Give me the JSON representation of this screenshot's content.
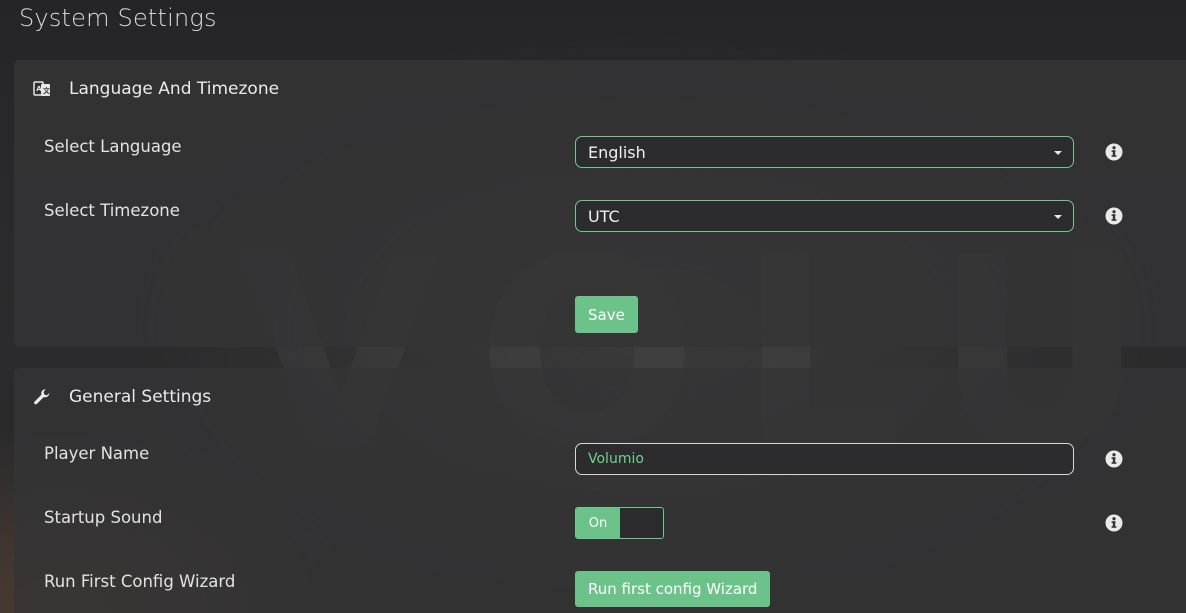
{
  "page": {
    "title": "System Settings",
    "watermark": "VOLUMIO"
  },
  "language_timezone": {
    "title": "Language And Timezone",
    "icon": "language-icon",
    "language": {
      "label": "Select Language",
      "value": "English"
    },
    "timezone": {
      "label": "Select Timezone",
      "value": "UTC"
    },
    "save_label": "Save"
  },
  "general": {
    "title": "General Settings",
    "icon": "wrench-icon",
    "player_name": {
      "label": "Player Name",
      "value": "Volumio"
    },
    "startup_sound": {
      "label": "Startup Sound",
      "state_label": "On",
      "enabled": true
    },
    "wizard": {
      "label": "Run First Config Wizard",
      "button_label": "Run first config Wizard"
    }
  },
  "colors": {
    "accent": "#6cc38a",
    "panel": "#343436",
    "background": "#2a2a2c"
  }
}
